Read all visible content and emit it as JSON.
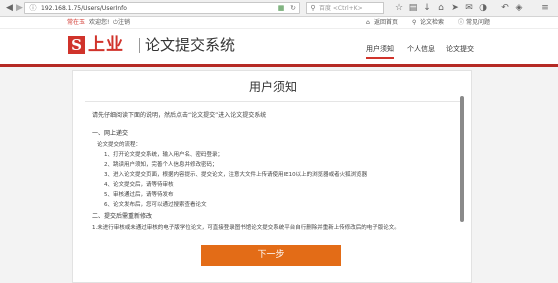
{
  "browser": {
    "url": "192.168.1.75/Users/UserInfo",
    "search_placeholder": "百度 <Ctrl+K>"
  },
  "topbar": {
    "username": "常在玉",
    "welcome": "欢迎您!",
    "logout": "注销",
    "links": [
      "返回首页",
      "论文检索",
      "常见问题"
    ]
  },
  "header": {
    "logo_char": "S",
    "logo_name": "上业",
    "system_title": "论文提交系统",
    "nav": [
      "用户须知",
      "个人信息",
      "论文提交"
    ],
    "active_nav": "用户须知"
  },
  "panel": {
    "title": "用户须知",
    "intro": "请先仔细阅读下面的说明，然后点击“论文提交”进入论文提交系统",
    "section1_title": "一、网上递交",
    "section1_sub": "论文提交的流程：",
    "steps": [
      "1、打开论文提交系统，输入用户名、密码登录；",
      "2、跳读用户须知，完善个人信息并修改密码；",
      "3、进入论文提交页面，根据内容提示、提交论文，注意大文件上传请使用IE10以上的浏览器或者火狐浏览器",
      "4、论文提交后，请等待审核",
      "5、审核通过后，请等待发布",
      "6、论文发布后，您可以通过搜索查看论文"
    ],
    "section2_title": "二、提交后需重新修改",
    "section2_text": "1.未进行审核或未通过审核的电子版学位论文，可直接登录图书馆论文提交系统平台自行删除并重新上传修改后的电子版论文。",
    "next_button": "下一步"
  },
  "colors": {
    "brand_red": "#d0332b",
    "header_bar": "#b52a24",
    "button_orange": "#e36c17"
  }
}
